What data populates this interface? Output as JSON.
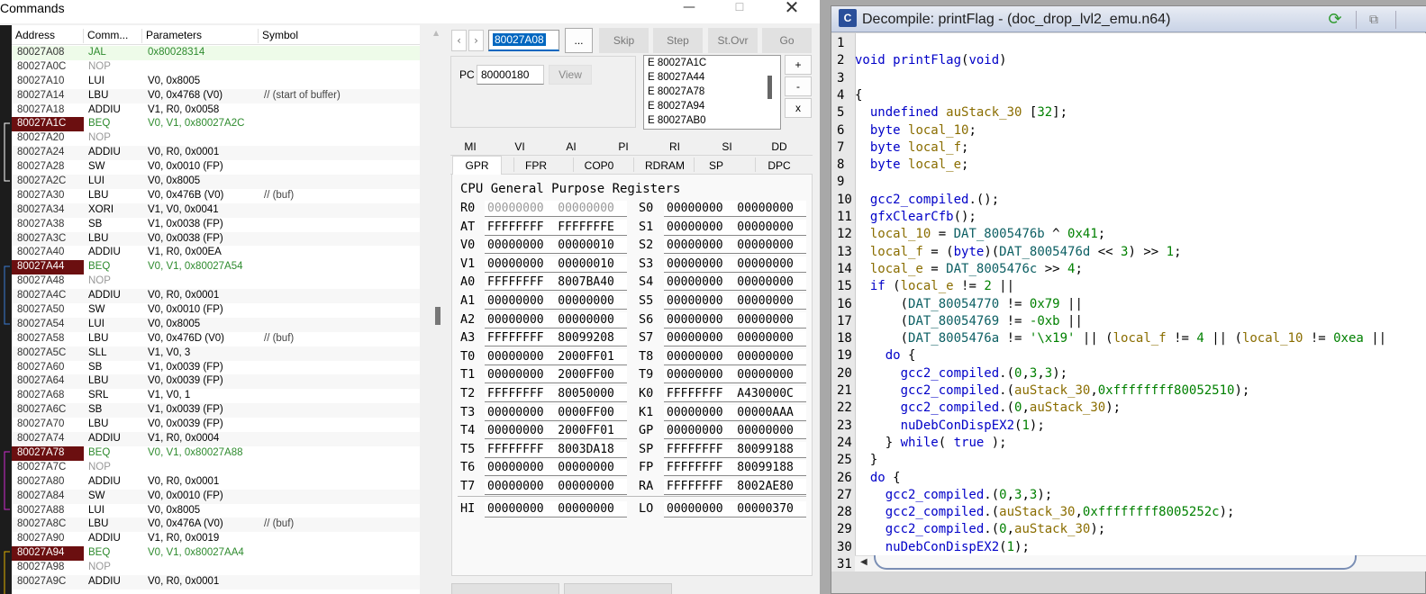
{
  "debugger": {
    "title": "Commands",
    "window_controls": {
      "minimize": "—",
      "maximize": "☐",
      "close": "✕"
    },
    "table": {
      "columns": [
        "Address",
        "Comm...",
        "Parameters",
        "Symbol"
      ],
      "rows": [
        {
          "addr": "80027A08",
          "cmd": "JAL",
          "par": "0x80028314",
          "sym": "",
          "kind": "current"
        },
        {
          "addr": "80027A0C",
          "cmd": "NOP",
          "par": "",
          "sym": "",
          "kind": "nop"
        },
        {
          "addr": "80027A10",
          "cmd": "LUI",
          "par": "V0, 0x8005",
          "sym": "",
          "kind": ""
        },
        {
          "addr": "80027A14",
          "cmd": "LBU",
          "par": "V0, 0x4768 (V0)",
          "sym": "// (start of buffer)",
          "kind": ""
        },
        {
          "addr": "80027A18",
          "cmd": "ADDIU",
          "par": "V1, R0, 0x0058",
          "sym": "",
          "kind": ""
        },
        {
          "addr": "80027A1C",
          "cmd": "BEQ",
          "par": "V0, V1, 0x80027A2C",
          "sym": "",
          "kind": "branch"
        },
        {
          "addr": "80027A20",
          "cmd": "NOP",
          "par": "",
          "sym": "",
          "kind": "nop"
        },
        {
          "addr": "80027A24",
          "cmd": "ADDIU",
          "par": "V0, R0, 0x0001",
          "sym": "",
          "kind": ""
        },
        {
          "addr": "80027A28",
          "cmd": "SW",
          "par": "V0, 0x0010 (FP)",
          "sym": "",
          "kind": ""
        },
        {
          "addr": "80027A2C",
          "cmd": "LUI",
          "par": "V0, 0x8005",
          "sym": "",
          "kind": ""
        },
        {
          "addr": "80027A30",
          "cmd": "LBU",
          "par": "V0, 0x476B (V0)",
          "sym": "// (buf)",
          "kind": ""
        },
        {
          "addr": "80027A34",
          "cmd": "XORI",
          "par": "V1, V0, 0x0041",
          "sym": "",
          "kind": ""
        },
        {
          "addr": "80027A38",
          "cmd": "SB",
          "par": "V1, 0x0038 (FP)",
          "sym": "",
          "kind": ""
        },
        {
          "addr": "80027A3C",
          "cmd": "LBU",
          "par": "V0, 0x0038 (FP)",
          "sym": "",
          "kind": ""
        },
        {
          "addr": "80027A40",
          "cmd": "ADDIU",
          "par": "V1, R0, 0x00EA",
          "sym": "",
          "kind": ""
        },
        {
          "addr": "80027A44",
          "cmd": "BEQ",
          "par": "V0, V1, 0x80027A54",
          "sym": "",
          "kind": "branch"
        },
        {
          "addr": "80027A48",
          "cmd": "NOP",
          "par": "",
          "sym": "",
          "kind": "nop"
        },
        {
          "addr": "80027A4C",
          "cmd": "ADDIU",
          "par": "V0, R0, 0x0001",
          "sym": "",
          "kind": ""
        },
        {
          "addr": "80027A50",
          "cmd": "SW",
          "par": "V0, 0x0010 (FP)",
          "sym": "",
          "kind": ""
        },
        {
          "addr": "80027A54",
          "cmd": "LUI",
          "par": "V0, 0x8005",
          "sym": "",
          "kind": ""
        },
        {
          "addr": "80027A58",
          "cmd": "LBU",
          "par": "V0, 0x476D (V0)",
          "sym": "// (buf)",
          "kind": ""
        },
        {
          "addr": "80027A5C",
          "cmd": "SLL",
          "par": "V1, V0, 3",
          "sym": "",
          "kind": ""
        },
        {
          "addr": "80027A60",
          "cmd": "SB",
          "par": "V1, 0x0039 (FP)",
          "sym": "",
          "kind": ""
        },
        {
          "addr": "80027A64",
          "cmd": "LBU",
          "par": "V0, 0x0039 (FP)",
          "sym": "",
          "kind": ""
        },
        {
          "addr": "80027A68",
          "cmd": "SRL",
          "par": "V1, V0, 1",
          "sym": "",
          "kind": ""
        },
        {
          "addr": "80027A6C",
          "cmd": "SB",
          "par": "V1, 0x0039 (FP)",
          "sym": "",
          "kind": ""
        },
        {
          "addr": "80027A70",
          "cmd": "LBU",
          "par": "V0, 0x0039 (FP)",
          "sym": "",
          "kind": ""
        },
        {
          "addr": "80027A74",
          "cmd": "ADDIU",
          "par": "V1, R0, 0x0004",
          "sym": "",
          "kind": ""
        },
        {
          "addr": "80027A78",
          "cmd": "BEQ",
          "par": "V0, V1, 0x80027A88",
          "sym": "",
          "kind": "branch"
        },
        {
          "addr": "80027A7C",
          "cmd": "NOP",
          "par": "",
          "sym": "",
          "kind": "nop"
        },
        {
          "addr": "80027A80",
          "cmd": "ADDIU",
          "par": "V0, R0, 0x0001",
          "sym": "",
          "kind": ""
        },
        {
          "addr": "80027A84",
          "cmd": "SW",
          "par": "V0, 0x0010 (FP)",
          "sym": "",
          "kind": ""
        },
        {
          "addr": "80027A88",
          "cmd": "LUI",
          "par": "V0, 0x8005",
          "sym": "",
          "kind": ""
        },
        {
          "addr": "80027A8C",
          "cmd": "LBU",
          "par": "V0, 0x476A (V0)",
          "sym": "// (buf)",
          "kind": ""
        },
        {
          "addr": "80027A90",
          "cmd": "ADDIU",
          "par": "V1, R0, 0x0019",
          "sym": "",
          "kind": ""
        },
        {
          "addr": "80027A94",
          "cmd": "BEQ",
          "par": "V0, V1, 0x80027AA4",
          "sym": "",
          "kind": "branch"
        },
        {
          "addr": "80027A98",
          "cmd": "NOP",
          "par": "",
          "sym": "",
          "kind": "nop"
        },
        {
          "addr": "80027A9C",
          "cmd": "ADDIU",
          "par": "V0, R0, 0x0001",
          "sym": "",
          "kind": ""
        }
      ]
    },
    "toolbar": {
      "prev": "‹",
      "next": "›",
      "goto_value": "80027A08",
      "dots": "...",
      "skip": "Skip",
      "step": "Step",
      "stovr": "St.Ovr",
      "go": "Go"
    },
    "pc": {
      "label": "PC",
      "value": "80000180",
      "view": "View"
    },
    "breakpoints": {
      "items": [
        "E 80027A1C",
        "E 80027A44",
        "E 80027A78",
        "E 80027A94",
        "E 80027AB0"
      ],
      "add": "+",
      "remove": "-",
      "clear": "x"
    },
    "tabs_row1": [
      "MI",
      "VI",
      "AI",
      "PI",
      "RI",
      "SI",
      "DD"
    ],
    "tabs_row2": [
      "GPR",
      "FPR",
      "COP0",
      "RDRAM",
      "SP",
      "DPC"
    ],
    "selected_tab": "GPR",
    "registers": {
      "title": "CPU General Purpose Registers",
      "left": [
        {
          "name": "R0",
          "value": "00000000  00000000",
          "zero": true
        },
        {
          "name": "AT",
          "value": "FFFFFFFF  FFFFFFFE"
        },
        {
          "name": "V0",
          "value": "00000000  00000010"
        },
        {
          "name": "V1",
          "value": "00000000  00000010"
        },
        {
          "name": "A0",
          "value": "FFFFFFFF  8007BA40"
        },
        {
          "name": "A1",
          "value": "00000000  00000000"
        },
        {
          "name": "A2",
          "value": "00000000  00000000"
        },
        {
          "name": "A3",
          "value": "FFFFFFFF  80099208"
        },
        {
          "name": "T0",
          "value": "00000000  2000FF01"
        },
        {
          "name": "T1",
          "value": "00000000  2000FF00"
        },
        {
          "name": "T2",
          "value": "FFFFFFFF  80050000"
        },
        {
          "name": "T3",
          "value": "00000000  0000FF00"
        },
        {
          "name": "T4",
          "value": "00000000  2000FF01"
        },
        {
          "name": "T5",
          "value": "FFFFFFFF  8003DA18"
        },
        {
          "name": "T6",
          "value": "00000000  00000000"
        },
        {
          "name": "T7",
          "value": "00000000  00000000"
        }
      ],
      "right": [
        {
          "name": "S0",
          "value": "00000000  00000000"
        },
        {
          "name": "S1",
          "value": "00000000  00000000"
        },
        {
          "name": "S2",
          "value": "00000000  00000000"
        },
        {
          "name": "S3",
          "value": "00000000  00000000"
        },
        {
          "name": "S4",
          "value": "00000000  00000000"
        },
        {
          "name": "S5",
          "value": "00000000  00000000"
        },
        {
          "name": "S6",
          "value": "00000000  00000000"
        },
        {
          "name": "S7",
          "value": "00000000  00000000"
        },
        {
          "name": "T8",
          "value": "00000000  00000000"
        },
        {
          "name": "T9",
          "value": "00000000  00000000"
        },
        {
          "name": "K0",
          "value": "FFFFFFFF  A430000C"
        },
        {
          "name": "K1",
          "value": "00000000  00000AAA"
        },
        {
          "name": "GP",
          "value": "00000000  00000000"
        },
        {
          "name": "SP",
          "value": "FFFFFFFF  80099188"
        },
        {
          "name": "FP",
          "value": "FFFFFFFF  80099188"
        },
        {
          "name": "RA",
          "value": "FFFFFFFF  8002AE80"
        }
      ],
      "hi": {
        "name": "HI",
        "value": "00000000  00000000"
      },
      "lo": {
        "name": "LO",
        "value": "00000000  00000370"
      }
    }
  },
  "decompiler": {
    "logo": "C",
    "title": "Decompile: printFlag -  (doc_drop_lvl2_emu.n64)",
    "refresh_icon": "⟳",
    "copy_icon": "⧉",
    "lines": [
      "",
      "void printFlag(void)",
      "",
      "{",
      "  undefined auStack_30 [32];",
      "  byte local_10;",
      "  byte local_f;",
      "  byte local_e;",
      "",
      "  gcc2_compiled.();",
      "  gfxClearCfb();",
      "  local_10 = DAT_8005476b ^ 0x41;",
      "  local_f = (byte)(DAT_8005476d << 3) >> 1;",
      "  local_e = DAT_8005476c >> 4;",
      "  if (local_e != 2 ||",
      "      (DAT_80054770 != 0x79 ||",
      "      (DAT_80054769 != -0xb ||",
      "      (DAT_8005476a != '\\x19' || (local_f != 4 || (local_10 != 0xea ||",
      "    do {",
      "      gcc2_compiled.(0,3,3);",
      "      gcc2_compiled.(auStack_30,0xffffffff80052510);",
      "      gcc2_compiled.(0,auStack_30);",
      "      nuDebConDispEX2(1);",
      "    } while( true );",
      "  }",
      "  do {",
      "    gcc2_compiled.(0,3,3);",
      "    gcc2_compiled.(auStack_30,0xffffffff8005252c);",
      "    gcc2_compiled.(0,auStack_30);",
      "    nuDebConDispEX2(1);",
      ""
    ],
    "line_numbers": [
      "1",
      "2",
      "3",
      "4",
      "5",
      "6",
      "7",
      "8",
      "9",
      "10",
      "11",
      "12",
      "13",
      "14",
      "15",
      "16",
      "17",
      "18",
      "19",
      "20",
      "21",
      "22",
      "23",
      "24",
      "25",
      "26",
      "27",
      "28",
      "29",
      "30",
      "31"
    ],
    "scroll_left": "◀"
  }
}
